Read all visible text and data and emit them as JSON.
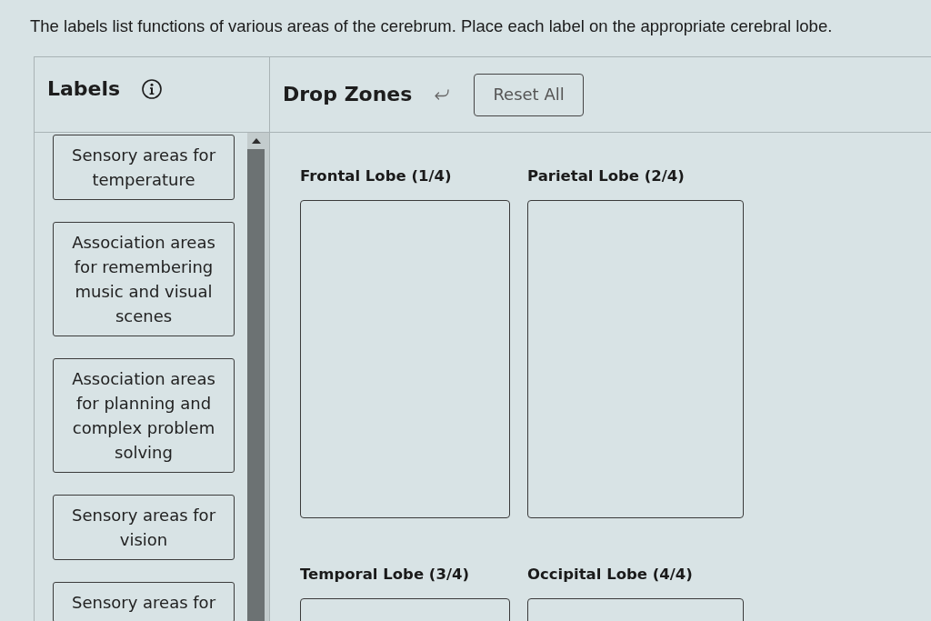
{
  "instructions": "The labels list functions of various areas of the cerebrum. Place each label on the appropriate cerebral lobe.",
  "labels_panel": {
    "title": "Labels",
    "labels": [
      "Sensory areas for temperature",
      "Association areas for remembering music and visual scenes",
      "Association areas for planning and complex problem solving",
      "Sensory areas for vision",
      "Sensory areas for"
    ]
  },
  "drop_zones_panel": {
    "title": "Drop Zones",
    "reset_button": "Reset All",
    "zones": [
      {
        "title": "Frontal Lobe (1/4)"
      },
      {
        "title": "Parietal Lobe (2/4)"
      },
      {
        "title": "Temporal Lobe (3/4)"
      },
      {
        "title": "Occipital Lobe (4/4)"
      }
    ]
  }
}
